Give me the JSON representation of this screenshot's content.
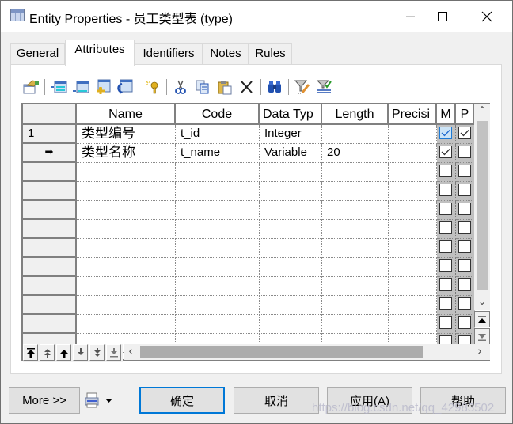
{
  "window": {
    "title": "Entity Properties - 员工类型表 (type)",
    "controls": {
      "minimize": "minimize",
      "maximize": "maximize",
      "close": "close"
    }
  },
  "tabs": [
    {
      "label": "General",
      "active": false
    },
    {
      "label": "Attributes",
      "active": true
    },
    {
      "label": "Identifiers",
      "active": false
    },
    {
      "label": "Notes",
      "active": false
    },
    {
      "label": "Rules",
      "active": false
    }
  ],
  "toolbar": {
    "buttons": [
      "properties-icon",
      "insert-row-icon",
      "add-row-icon",
      "add-attributes-icon",
      "reuse-attributes-icon",
      "create-key-icon",
      "cut-icon",
      "copy-icon",
      "paste-icon",
      "delete-icon",
      "find-icon",
      "customize-filter-icon",
      "filter-icon"
    ]
  },
  "grid": {
    "columns": [
      "",
      "Name",
      "Code",
      "Data Typ",
      "Length",
      "Precisi",
      "M",
      "P"
    ],
    "rows": [
      {
        "header": "1",
        "name": "类型编号",
        "code": "t_id",
        "data_type": "Integer",
        "length": "",
        "precision": "",
        "m": true,
        "p": true,
        "m_highlight": true
      },
      {
        "header": "➡",
        "name": "类型名称",
        "code": "t_name",
        "data_type": "Variable",
        "length": "20",
        "precision": "",
        "m": true,
        "p": false,
        "m_highlight": false
      },
      {
        "header": "",
        "name": "",
        "code": "",
        "data_type": "",
        "length": "",
        "precision": "",
        "m": false,
        "p": false
      },
      {
        "header": "",
        "name": "",
        "code": "",
        "data_type": "",
        "length": "",
        "precision": "",
        "m": false,
        "p": false
      },
      {
        "header": "",
        "name": "",
        "code": "",
        "data_type": "",
        "length": "",
        "precision": "",
        "m": false,
        "p": false
      },
      {
        "header": "",
        "name": "",
        "code": "",
        "data_type": "",
        "length": "",
        "precision": "",
        "m": false,
        "p": false
      },
      {
        "header": "",
        "name": "",
        "code": "",
        "data_type": "",
        "length": "",
        "precision": "",
        "m": false,
        "p": false
      },
      {
        "header": "",
        "name": "",
        "code": "",
        "data_type": "",
        "length": "",
        "precision": "",
        "m": false,
        "p": false
      },
      {
        "header": "",
        "name": "",
        "code": "",
        "data_type": "",
        "length": "",
        "precision": "",
        "m": false,
        "p": false
      },
      {
        "header": "",
        "name": "",
        "code": "",
        "data_type": "",
        "length": "",
        "precision": "",
        "m": false,
        "p": false
      },
      {
        "header": "",
        "name": "",
        "code": "",
        "data_type": "",
        "length": "",
        "precision": "",
        "m": false,
        "p": false
      },
      {
        "header": "",
        "name": "",
        "code": "",
        "data_type": "",
        "length": "",
        "precision": "",
        "m": false,
        "p": false
      }
    ],
    "nav_buttons": [
      "move-to-top",
      "move-page-up",
      "move-up",
      "move-down",
      "move-page-down",
      "move-to-bottom"
    ]
  },
  "footer": {
    "more_label": "More >>",
    "ok_label": "确定",
    "cancel_label": "取消",
    "apply_label": "应用(A)",
    "help_label": "帮助"
  },
  "watermark": "https://blog.csdn.net/qq_42983502",
  "colors": {
    "accent": "#0078d7",
    "checkbox_highlight": "#cce4f7",
    "grid_border": "#808080",
    "scroll_thumb": "#acacac"
  }
}
